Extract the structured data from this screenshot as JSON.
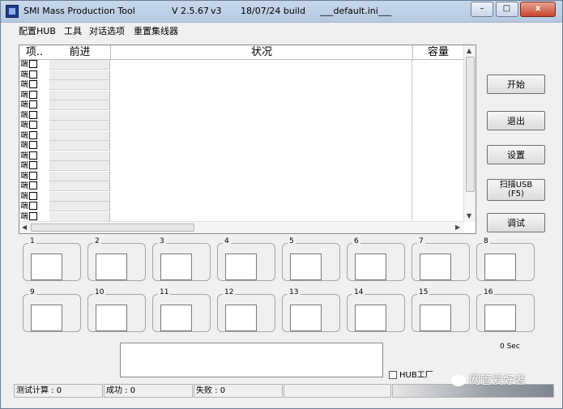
{
  "title": {
    "app": "SMI Mass Production Tool",
    "version": "V 2.5.67",
    "rev": "v3",
    "build": "18/07/24 build",
    "ini": "___default.ini___"
  },
  "menu": [
    "配置HUB",
    "工具",
    "对话选项",
    "重置集线器"
  ],
  "grid": {
    "columns": [
      "项..",
      "前进",
      "状况",
      "容量"
    ],
    "row_label": "端",
    "row_count": 16
  },
  "buttons": {
    "start": "开始",
    "exit": "退出",
    "settings": "设置",
    "scan_usb_line1": "扫描USB",
    "scan_usb_line2": "(F5)",
    "debug": "调试"
  },
  "ports": [
    "1",
    "2",
    "3",
    "4",
    "5",
    "6",
    "7",
    "8",
    "9",
    "10",
    "11",
    "12",
    "13",
    "14",
    "15",
    "16"
  ],
  "timer": "0 Sec",
  "hub_checkbox": "HUB工厂",
  "statusbar": {
    "test_count": "测试计算 : 0",
    "success": "成功 : 0",
    "fail": "失败 : 0"
  },
  "watermark": "网管爱好者",
  "window_controls": {
    "min": "–",
    "max": "□",
    "close": "x"
  }
}
